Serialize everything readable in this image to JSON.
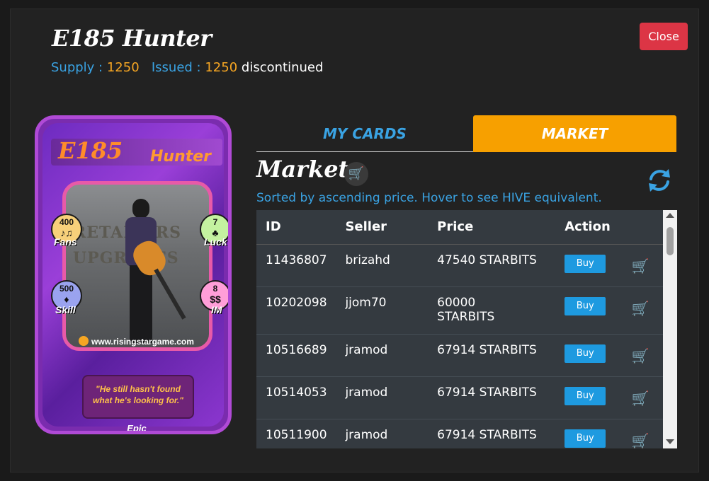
{
  "header": {
    "title": "E185 Hunter",
    "supply_label": "Supply :",
    "supply_value": "1250",
    "issued_label": "Issued :",
    "issued_value": "1250",
    "status": "discontinued",
    "close_label": "Close"
  },
  "card": {
    "code": "E185",
    "name": "Hunter",
    "photo_sign": "RETAILERS UPGRADES",
    "stats": {
      "fans": {
        "value": "400",
        "label": "Fans"
      },
      "luck": {
        "value": "7",
        "label": "Luck"
      },
      "skill": {
        "value": "500",
        "label": "Skill"
      },
      "im": {
        "value": "8",
        "label": "IM"
      }
    },
    "url": "www.risingstargame.com",
    "quote": "\"He still hasn't found what he's looking for.\"",
    "rarity": "Epic"
  },
  "tabs": {
    "my_cards": "MY CARDS",
    "market": "MARKET",
    "active": "market"
  },
  "market": {
    "title": "Market",
    "sort_note": "Sorted by ascending price. Hover to see HIVE equivalent.",
    "columns": [
      "ID",
      "Seller",
      "Price",
      "Action"
    ],
    "buy_label": "Buy",
    "rows": [
      {
        "id": "11436807",
        "seller": "brizahd",
        "price": "47540 STARBITS"
      },
      {
        "id": "10202098",
        "seller": "jjom70",
        "price": "60000 STARBITS"
      },
      {
        "id": "10516689",
        "seller": "jramod",
        "price": "67914 STARBITS"
      },
      {
        "id": "10514053",
        "seller": "jramod",
        "price": "67914 STARBITS"
      },
      {
        "id": "10511900",
        "seller": "jramod",
        "price": "67914 STARBITS"
      }
    ]
  },
  "colors": {
    "accent_blue": "#3aa3e3",
    "accent_orange": "#f7a000",
    "close_red": "#dc3545",
    "cart_green": "#32c832"
  },
  "icons": {
    "cart": "shopping-cart-icon",
    "refresh": "refresh-icon"
  }
}
